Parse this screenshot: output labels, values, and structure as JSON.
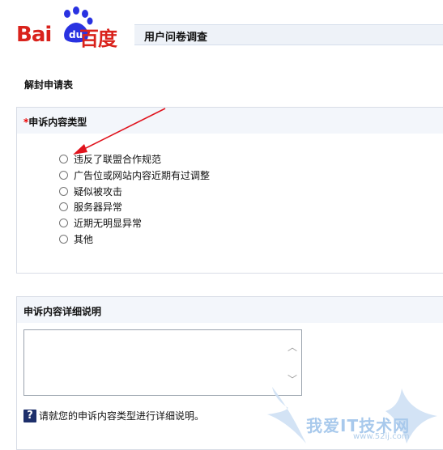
{
  "logo": {
    "left_text": "Bai",
    "paw_text": "du",
    "right_text": "百度",
    "color": "#d9221b"
  },
  "header": {
    "title": "用户问卷调查"
  },
  "form": {
    "title": "解封申请表"
  },
  "section_type": {
    "required_mark": "*",
    "label": "申诉内容类型",
    "options": [
      {
        "label": "违反了联盟合作规范",
        "selected": false
      },
      {
        "label": "广告位或网站内容近期有过调整",
        "selected": false
      },
      {
        "label": "疑似被攻击",
        "selected": false
      },
      {
        "label": "服务器异常",
        "selected": false
      },
      {
        "label": "近期无明显异常",
        "selected": false
      },
      {
        "label": "其他",
        "selected": false
      }
    ]
  },
  "section_detail": {
    "label": "申诉内容详细说明",
    "textarea_value": "",
    "help_icon": "?",
    "help_text": "请就您的申诉内容类型进行详细说明。"
  },
  "watermark": {
    "text": "我爱IT技术网",
    "url": "www.52ij.com"
  },
  "annotation": {
    "arrow_color": "#e0141e"
  }
}
